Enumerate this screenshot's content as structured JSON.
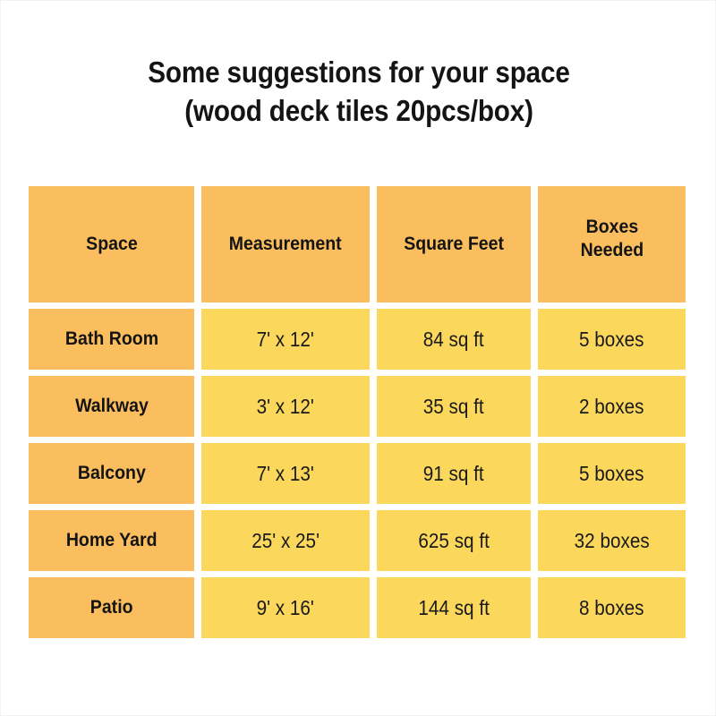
{
  "title": {
    "line1": "Some suggestions for your space",
    "line2": "(wood deck tiles 20pcs/box)"
  },
  "colors": {
    "background": "#ffffff",
    "header_cell": "#fbbe5e",
    "label_cell": "#fbbe5e",
    "value_cell": "#fbd75b",
    "text": "#141414",
    "page_border": "#f2f2f2"
  },
  "table": {
    "columns": [
      {
        "key": "space",
        "label": "Space"
      },
      {
        "key": "measurement",
        "label": "Measurement"
      },
      {
        "key": "square_feet",
        "label": "Square Feet"
      },
      {
        "key": "boxes_needed",
        "label_line1": "Boxes",
        "label_line2": "Needed",
        "label": "Boxes Needed"
      }
    ],
    "rows": [
      {
        "space": "Bath Room",
        "measurement": "7' x 12'",
        "square_feet": "84 sq ft",
        "boxes_needed": "5 boxes"
      },
      {
        "space": "Walkway",
        "measurement": "3' x 12'",
        "square_feet": "35 sq ft",
        "boxes_needed": "2 boxes"
      },
      {
        "space": "Balcony",
        "measurement": "7' x 13'",
        "square_feet": "91 sq ft",
        "boxes_needed": "5 boxes"
      },
      {
        "space": "Home Yard",
        "measurement": "25' x 25'",
        "square_feet": "625 sq ft",
        "boxes_needed": "32 boxes"
      },
      {
        "space": "Patio",
        "measurement": "9' x 16'",
        "square_feet": "144 sq ft",
        "boxes_needed": "8 boxes"
      }
    ]
  },
  "chart_data": {
    "type": "table",
    "title": "Some suggestions for your space (wood deck tiles 20pcs/box)",
    "columns": [
      "Space",
      "Measurement",
      "Square Feet",
      "Boxes Needed"
    ],
    "rows": [
      [
        "Bath Room",
        "7' x 12'",
        "84 sq ft",
        "5 boxes"
      ],
      [
        "Walkway",
        "3' x 12'",
        "35 sq ft",
        "2 boxes"
      ],
      [
        "Balcony",
        "7' x 13'",
        "91 sq ft",
        "5 boxes"
      ],
      [
        "Home Yard",
        "25' x 25'",
        "625 sq ft",
        "32 boxes"
      ],
      [
        "Patio",
        "9' x 16'",
        "144 sq ft",
        "8 boxes"
      ]
    ],
    "square_feet_values": [
      84,
      35,
      91,
      625,
      144
    ],
    "boxes_needed_values": [
      5,
      2,
      5,
      32,
      8
    ],
    "tiles_per_box": 20,
    "xlabel": "",
    "ylabel": "",
    "legend": []
  }
}
